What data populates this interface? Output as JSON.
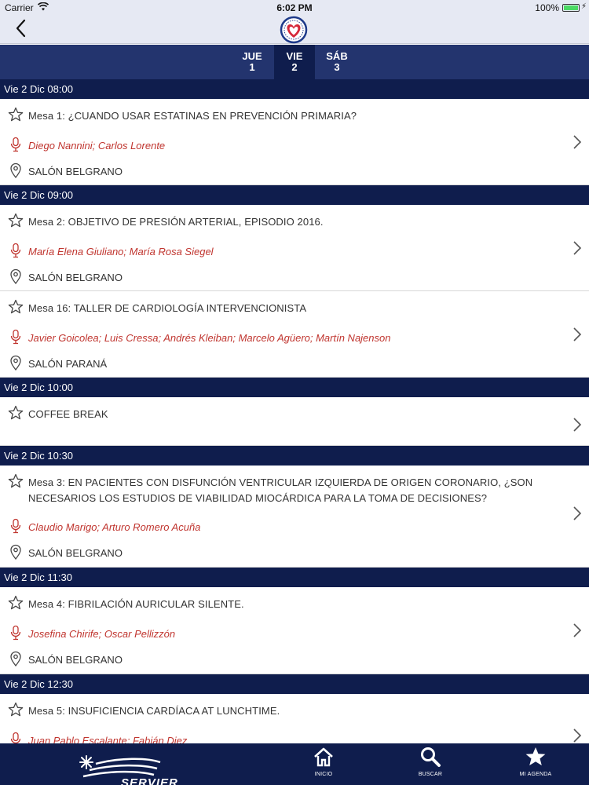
{
  "status": {
    "carrier": "Carrier",
    "time": "6:02 PM",
    "battery": "100%"
  },
  "tabs": [
    {
      "day": "JUE",
      "num": "1"
    },
    {
      "day": "VIE",
      "num": "2"
    },
    {
      "day": "SÁB",
      "num": "3"
    }
  ],
  "sections": [
    {
      "time": "Vie 2 Dic 08:00"
    },
    {
      "time": "Vie 2 Dic 09:00"
    },
    {
      "time": "Vie 2 Dic 10:00"
    },
    {
      "time": "Vie 2 Dic 10:30"
    },
    {
      "time": "Vie 2 Dic 11:30"
    },
    {
      "time": "Vie 2 Dic 12:30"
    }
  ],
  "events": [
    {
      "title": "Mesa 1: ¿CUANDO USAR ESTATINAS EN PREVENCIÓN PRIMARIA?",
      "speakers": "Diego Nannini; Carlos Lorente",
      "room": "SALÓN BELGRANO"
    },
    {
      "title": "Mesa 2: OBJETIVO DE PRESIÓN ARTERIAL, EPISODIO 2016.",
      "speakers": "María Elena Giuliano; María Rosa Siegel",
      "room": "SALÓN BELGRANO"
    },
    {
      "title": "Mesa 16: TALLER DE CARDIOLOGÍA INTERVENCIONISTA",
      "speakers": "Javier Goicolea; Luis Cressa; Andrés Kleiban; Marcelo Agüero; Martín Najenson",
      "room": "SALÓN PARANÁ"
    },
    {
      "title": "COFFEE BREAK"
    },
    {
      "title": "Mesa 3: EN PACIENTES CON DISFUNCIÓN VENTRICULAR IZQUIERDA DE ORIGEN CORONARIO, ¿SON NECESARIOS LOS ESTUDIOS DE VIABILIDAD MIOCÁRDICA PARA LA TOMA DE DECISIONES?",
      "speakers": "Claudio Marigo; Arturo Romero Acuña",
      "room": "SALÓN BELGRANO"
    },
    {
      "title": "Mesa 4: FIBRILACIÓN AURICULAR SILENTE.",
      "speakers": "Josefina Chirife; Oscar Pellizzón",
      "room": "SALÓN BELGRANO"
    },
    {
      "title": "Mesa 5: INSUFICIENCIA CARDÍACA AT LUNCHTIME.",
      "speakers": "Juan Pablo Escalante; Fabián Diez"
    }
  ],
  "bottom_nav": {
    "brand": "SERVIER",
    "items": [
      {
        "label": "INICIO",
        "icon": "home-icon"
      },
      {
        "label": "BUSCAR",
        "icon": "search-icon"
      },
      {
        "label": "MI AGENDA",
        "icon": "star-icon"
      }
    ]
  },
  "colors": {
    "header_bg": "#e6e9f3",
    "tab_bar": "#23346e",
    "section_bg": "#0f1d4d",
    "speaker_red": "#c0352f"
  }
}
